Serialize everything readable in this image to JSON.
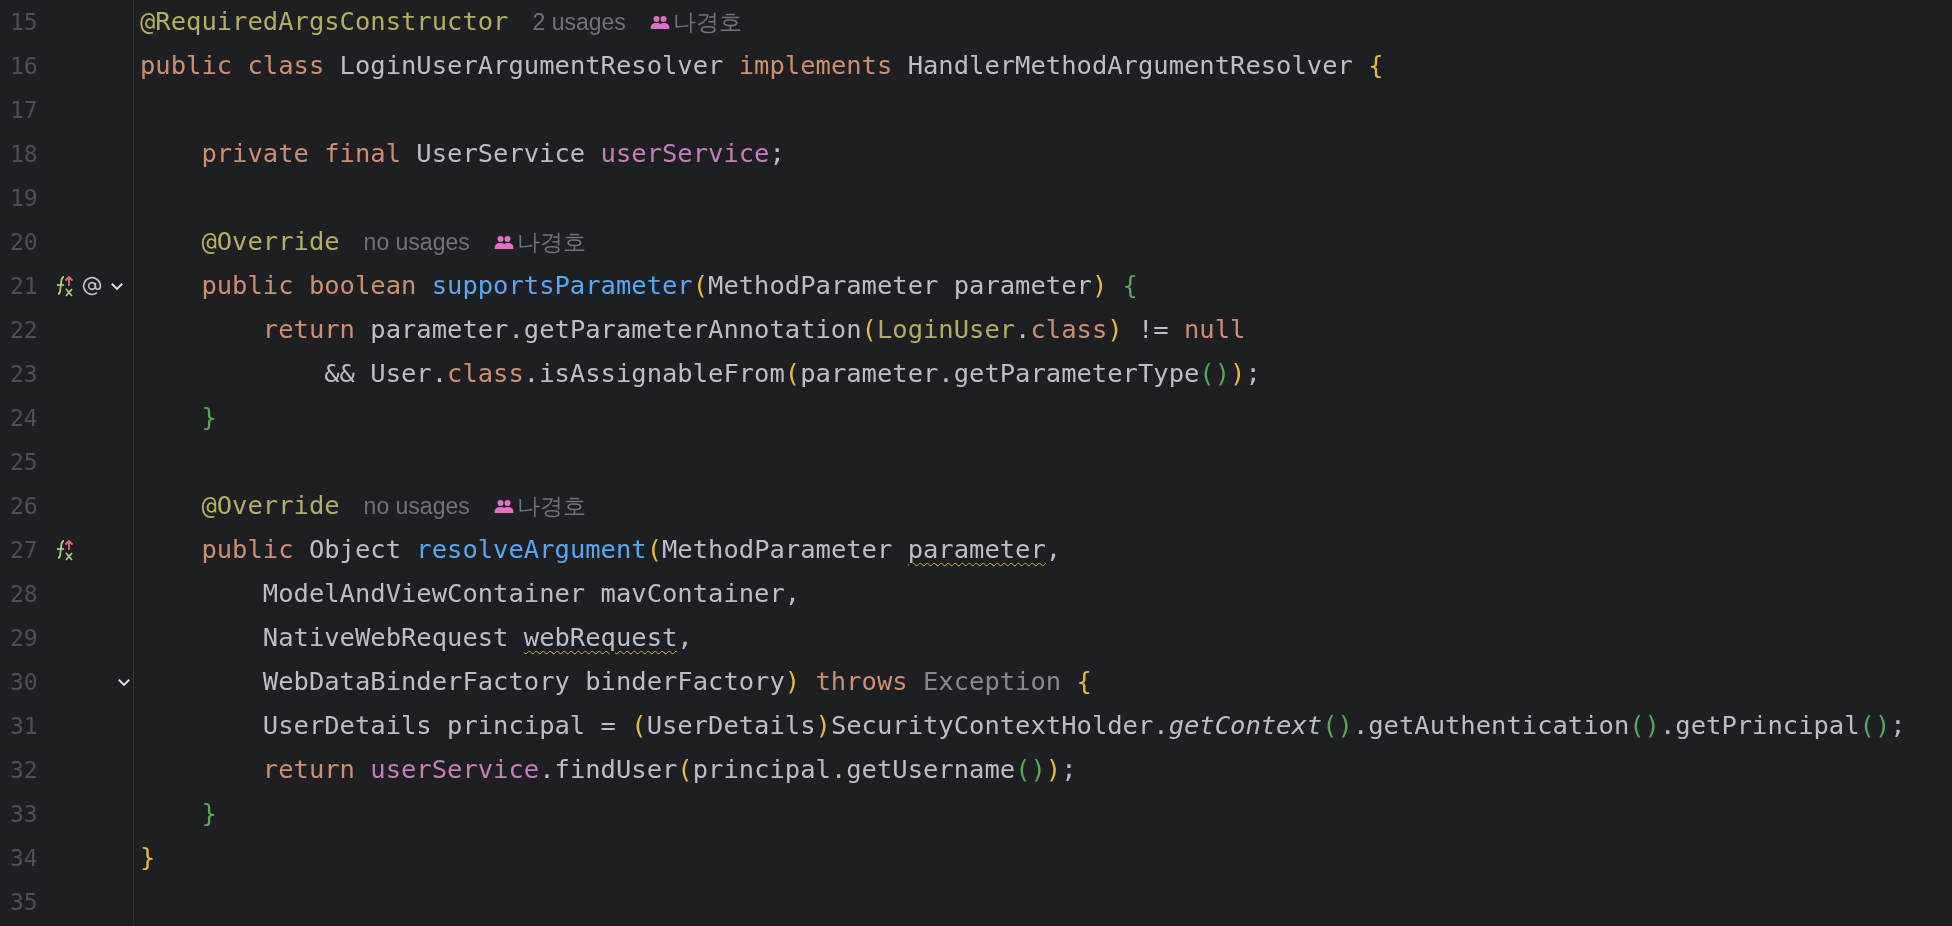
{
  "lines": [
    {
      "number": "15",
      "tokens": [
        {
          "text": "@RequiredArgsConstructor",
          "kind": "annotation"
        }
      ],
      "hints": {
        "usages": "2 usages",
        "author": "나경호"
      }
    },
    {
      "number": "16",
      "tokens": [
        {
          "text": "public class ",
          "kind": "keyword"
        },
        {
          "text": "LoginUserArgumentResolver ",
          "kind": "plain"
        },
        {
          "text": "implements ",
          "kind": "keyword"
        },
        {
          "text": "HandlerMethodArgumentResolver ",
          "kind": "plain"
        },
        {
          "text": "{",
          "kind": "brace1"
        }
      ]
    },
    {
      "number": "17"
    },
    {
      "number": "18",
      "tokens": [
        {
          "text": "    private final ",
          "kind": "keyword"
        },
        {
          "text": "UserService ",
          "kind": "plain"
        },
        {
          "text": "userService",
          "kind": "field"
        },
        {
          "text": ";",
          "kind": "plain"
        }
      ]
    },
    {
      "number": "19"
    },
    {
      "number": "20",
      "tokens": [
        {
          "text": "    @Override",
          "kind": "annotation"
        }
      ],
      "hints": {
        "usages": "no usages",
        "author": "나경호"
      }
    },
    {
      "number": "21",
      "gutter": [
        {
          "kind": "overrides"
        },
        {
          "kind": "annotated"
        },
        {
          "kind": "fold"
        }
      ],
      "tokens": [
        {
          "text": "    public boolean ",
          "kind": "keyword"
        },
        {
          "text": "supportsParameter",
          "kind": "method"
        },
        {
          "text": "(",
          "kind": "brace1"
        },
        {
          "text": "MethodParameter parameter",
          "kind": "plain"
        },
        {
          "text": ")",
          "kind": "brace1"
        },
        {
          "text": " {",
          "kind": "brace2"
        }
      ]
    },
    {
      "number": "22",
      "tokens": [
        {
          "text": "        return ",
          "kind": "keyword"
        },
        {
          "text": "parameter.getParameterAnnotation",
          "kind": "plain"
        },
        {
          "text": "(",
          "kind": "brace1"
        },
        {
          "text": "LoginUser",
          "kind": "annotation"
        },
        {
          "text": ".",
          "kind": "plain"
        },
        {
          "text": "class",
          "kind": "keyword"
        },
        {
          "text": ")",
          "kind": "brace1"
        },
        {
          "text": " != ",
          "kind": "plain"
        },
        {
          "text": "null",
          "kind": "keyword"
        }
      ]
    },
    {
      "number": "23",
      "tokens": [
        {
          "text": "            && User.",
          "kind": "plain"
        },
        {
          "text": "class",
          "kind": "keyword"
        },
        {
          "text": ".isAssignableFrom",
          "kind": "plain"
        },
        {
          "text": "(",
          "kind": "brace1"
        },
        {
          "text": "parameter.getParameterType",
          "kind": "plain"
        },
        {
          "text": "()",
          "kind": "brace2"
        },
        {
          "text": ")",
          "kind": "brace1"
        },
        {
          "text": ";",
          "kind": "plain"
        }
      ]
    },
    {
      "number": "24",
      "tokens": [
        {
          "text": "    }",
          "kind": "brace2"
        }
      ]
    },
    {
      "number": "25"
    },
    {
      "number": "26",
      "tokens": [
        {
          "text": "    @Override",
          "kind": "annotation"
        }
      ],
      "hints": {
        "usages": "no usages",
        "author": "나경호"
      }
    },
    {
      "number": "27",
      "gutter": [
        {
          "kind": "overrides"
        }
      ],
      "tokens": [
        {
          "text": "    public ",
          "kind": "keyword"
        },
        {
          "text": "Object ",
          "kind": "plain"
        },
        {
          "text": "resolveArgument",
          "kind": "method"
        },
        {
          "text": "(",
          "kind": "brace1"
        },
        {
          "text": "MethodParameter ",
          "kind": "plain"
        },
        {
          "text": "parameter",
          "kind": "warning"
        },
        {
          "text": ",",
          "kind": "plain"
        }
      ]
    },
    {
      "number": "28",
      "tokens": [
        {
          "text": "        ModelAndViewContainer mavContainer,",
          "kind": "plain"
        }
      ]
    },
    {
      "number": "29",
      "tokens": [
        {
          "text": "        NativeWebRequest ",
          "kind": "plain"
        },
        {
          "text": "webRequest",
          "kind": "warning"
        },
        {
          "text": ",",
          "kind": "plain"
        }
      ]
    },
    {
      "number": "30",
      "gutter": [
        {
          "kind": "fold"
        }
      ],
      "tokens": [
        {
          "text": "        WebDataBinderFactory binderFactory",
          "kind": "plain"
        },
        {
          "text": ")",
          "kind": "brace1"
        },
        {
          "text": " throws ",
          "kind": "keyword"
        },
        {
          "text": "Exception ",
          "kind": "dim"
        },
        {
          "text": "{",
          "kind": "brace1"
        }
      ]
    },
    {
      "number": "31",
      "tokens": [
        {
          "text": "        UserDetails principal = ",
          "kind": "plain"
        },
        {
          "text": "(",
          "kind": "brace1"
        },
        {
          "text": "UserDetails",
          "kind": "plain"
        },
        {
          "text": ")",
          "kind": "brace1"
        },
        {
          "text": "SecurityContextHolder.",
          "kind": "plain"
        },
        {
          "text": "getContext",
          "kind": "italic"
        },
        {
          "text": "()",
          "kind": "brace2"
        },
        {
          "text": ".getAuthentication",
          "kind": "plain"
        },
        {
          "text": "()",
          "kind": "brace2"
        },
        {
          "text": ".getPrincipal",
          "kind": "plain"
        },
        {
          "text": "()",
          "kind": "brace2"
        },
        {
          "text": ";",
          "kind": "plain"
        }
      ]
    },
    {
      "number": "32",
      "tokens": [
        {
          "text": "        return ",
          "kind": "keyword"
        },
        {
          "text": "userService",
          "kind": "field"
        },
        {
          "text": ".findUser",
          "kind": "plain"
        },
        {
          "text": "(",
          "kind": "brace1"
        },
        {
          "text": "principal.getUsername",
          "kind": "plain"
        },
        {
          "text": "()",
          "kind": "brace2"
        },
        {
          "text": ")",
          "kind": "brace1"
        },
        {
          "text": ";",
          "kind": "plain"
        }
      ]
    },
    {
      "number": "33",
      "tokens": [
        {
          "text": "    }",
          "kind": "brace2"
        }
      ]
    },
    {
      "number": "34",
      "tokens": [
        {
          "text": "}",
          "kind": "brace1"
        }
      ]
    },
    {
      "number": "35"
    }
  ]
}
